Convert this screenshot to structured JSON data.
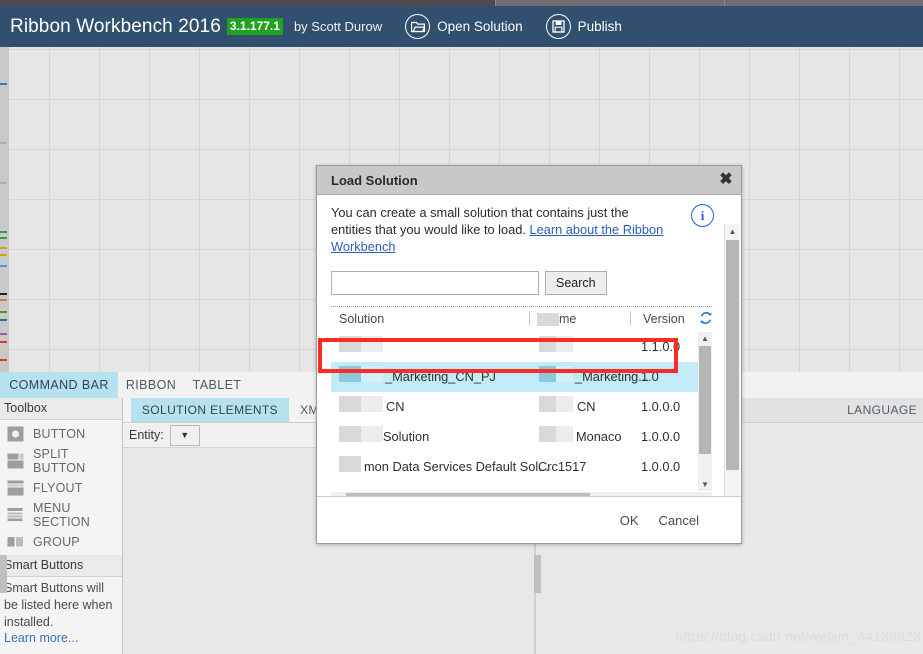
{
  "app": {
    "title": "Ribbon Workbench 2016",
    "version": "3.1.177.1",
    "author": "by Scott Durow",
    "actions": [
      {
        "label": "Open Solution",
        "icon": "open-folder-icon"
      },
      {
        "label": "Publish",
        "icon": "save-disk-icon"
      }
    ],
    "colors": {
      "header_bg": "#31506f",
      "version_badge_bg": "#22a022",
      "tab_active_bg": "#b6e2f0",
      "row_selected_bg": "#c3eaf7",
      "annotation_red": "#fb2c24",
      "link_blue": "#2b5fb5"
    }
  },
  "tabs": {
    "items": [
      {
        "label": "COMMAND BAR",
        "active": true
      },
      {
        "label": "RIBBON",
        "active": false
      },
      {
        "label": "TABLET",
        "active": false
      }
    ]
  },
  "toolbox": {
    "caption": "Toolbox",
    "items": [
      {
        "label": "BUTTON",
        "icon": "button-shape-icon"
      },
      {
        "label": "SPLIT BUTTON",
        "icon": "split-button-shape-icon"
      },
      {
        "label": "FLYOUT",
        "icon": "flyout-shape-icon"
      },
      {
        "label": "MENU SECTION",
        "icon": "menu-section-shape-icon"
      },
      {
        "label": "GROUP",
        "icon": "group-shape-icon"
      }
    ],
    "smart_buttons": {
      "caption": "Smart Buttons",
      "text": "Smart Buttons will be listed here when installed.",
      "link": "Learn more..."
    }
  },
  "mid_panel": {
    "tabs": [
      {
        "label": "SOLUTION ELEMENTS",
        "active": true
      },
      {
        "label": "XML",
        "active": false
      }
    ],
    "entity_label": "Entity:",
    "entity_value": ""
  },
  "right_panel": {
    "tab_label": "LANGUAGE"
  },
  "dialog": {
    "title": "Load Solution",
    "close_icon": "close-icon",
    "description_line1": "You can create a small solution that contains just the entities that",
    "description_line2": "you would like to load.",
    "description_link": "Learn about the Ribbon Workbench",
    "info_icon": "info-icon",
    "search": {
      "value": "",
      "placeholder": "",
      "button_label": "Search"
    },
    "grid": {
      "columns": [
        "Solution",
        "me",
        "Version"
      ],
      "refresh_icon": "refresh-icon",
      "rows": [
        {
          "solution": "",
          "name": "",
          "version": "1.1.0.0",
          "selected": false,
          "redacted": true
        },
        {
          "solution": "_Marketing_CN_PJ",
          "name": "_Marketing...",
          "version": "1.0",
          "selected": true,
          "redacted": true
        },
        {
          "solution": "CN",
          "name": "CN",
          "version": "1.0.0.0",
          "selected": false,
          "redacted": true
        },
        {
          "solution": "Solution",
          "name": "Monaco",
          "version": "1.0.0.0",
          "selected": false,
          "redacted": true
        },
        {
          "solution": "mon Data Services Default Sol...",
          "name": "Crc1517",
          "version": "1.0.0.0",
          "selected": false,
          "redacted": true
        }
      ]
    },
    "buttons": {
      "ok": "OK",
      "cancel": "Cancel"
    }
  },
  "watermark": "https://blog.csdn.net/weixin_44136823"
}
